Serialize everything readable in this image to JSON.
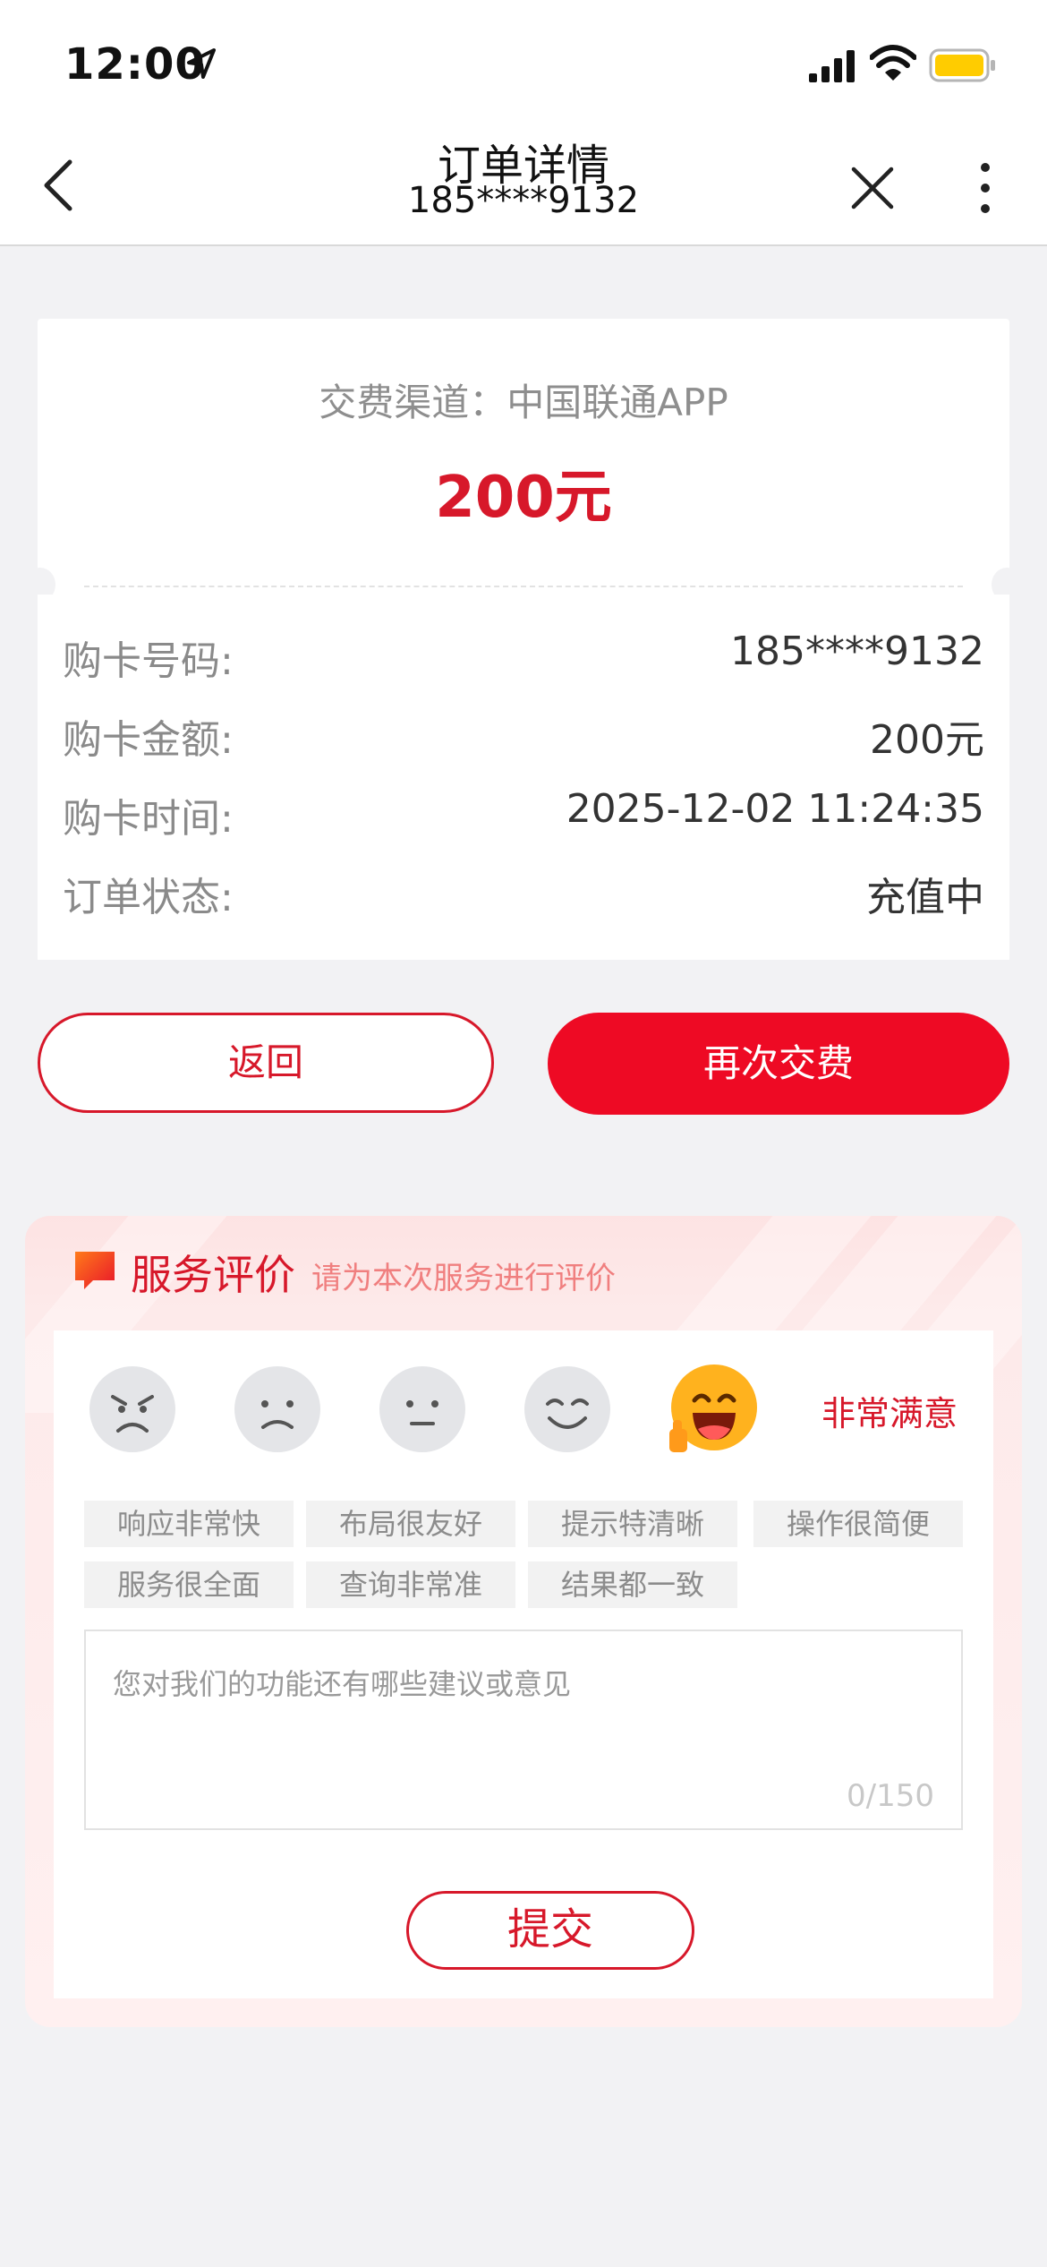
{
  "status_bar": {
    "time": "12:00"
  },
  "nav": {
    "title": "订单详情",
    "subtitle": "185****9132"
  },
  "order": {
    "channel": "交费渠道：中国联通APP",
    "amount": "200元",
    "rows": [
      {
        "label": "购卡号码:",
        "value": "185****9132"
      },
      {
        "label": "购卡金额:",
        "value": "200元"
      },
      {
        "label": "购卡时间:",
        "value": "2025-12-02 11:24:35"
      },
      {
        "label": "订单状态:",
        "value": "充值中"
      }
    ]
  },
  "actions": {
    "back_label": "返回",
    "pay_again_label": "再次交费"
  },
  "rating": {
    "title": "服务评价",
    "hint": "请为本次服务进行评价",
    "selected_level_label": "非常满意",
    "faces": [
      "angry-face-icon",
      "sad-face-icon",
      "neutral-face-icon",
      "smile-face-icon",
      "grinning-thumbs-up-face-icon"
    ],
    "selected_index": 4,
    "tags": [
      "响应非常快",
      "布局很友好",
      "提示特清晰",
      "操作很简便",
      "服务很全面",
      "查询非常准",
      "结果都一致"
    ],
    "feedback_placeholder": "您对我们的功能还有哪些建议或意见",
    "counter": "0/150",
    "submit_label": "提交"
  },
  "colors": {
    "accent": "#d7182a",
    "button_fill": "#ee0a24",
    "background": "#f2f2f4"
  }
}
